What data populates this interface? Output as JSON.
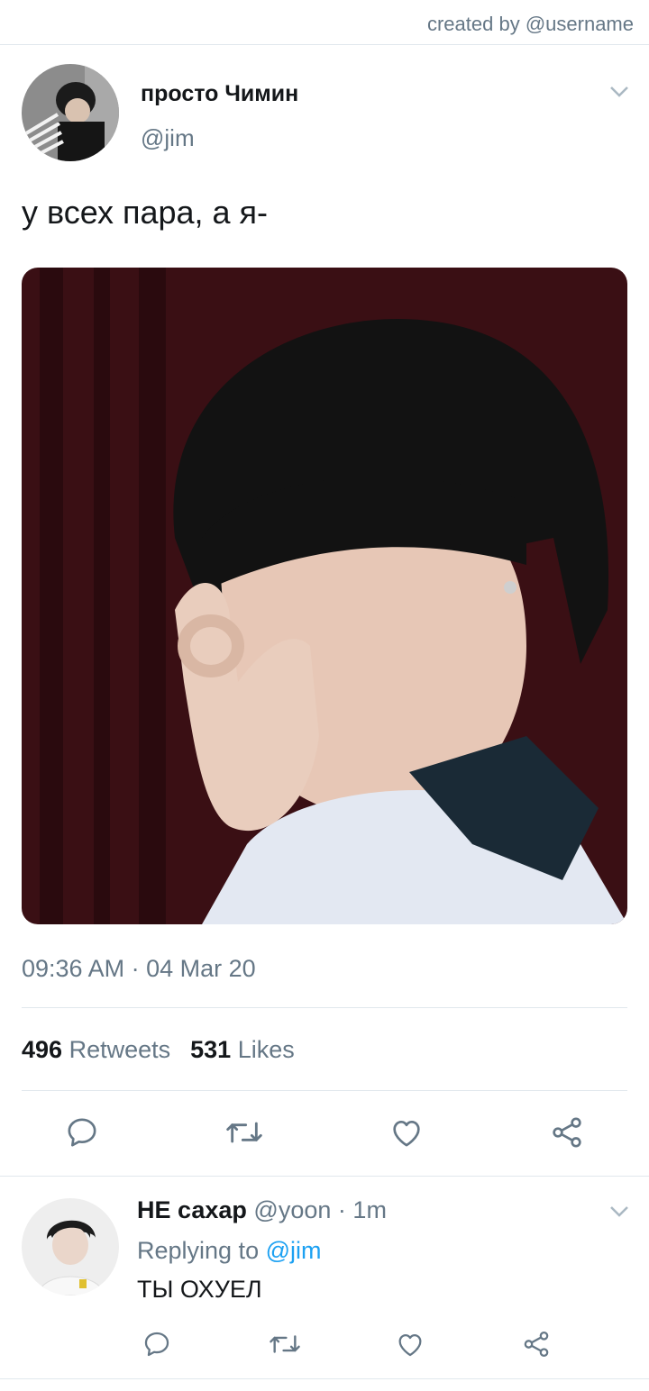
{
  "header": {
    "created_by": "created by @username"
  },
  "tweet": {
    "display_name": "просто Чимин",
    "handle": "@jim",
    "text": "у всех пара, а я-",
    "time": "09:36 AM",
    "separator": "·",
    "date": "04 Mar 20",
    "retweets_count": "496",
    "retweets_label": "Retweets",
    "likes_count": "531",
    "likes_label": "Likes"
  },
  "reply": {
    "display_name": "НЕ сахар",
    "handle": "@yoon",
    "separator": "·",
    "time_ago": "1m",
    "replying_prefix": "Replying to",
    "replying_to": "@jim",
    "text": "ТЫ ОХУЕЛ"
  },
  "icons": {
    "more": "chevron-down-icon",
    "reply": "speech-bubble-icon",
    "retweet": "retweet-icon",
    "like": "heart-icon",
    "share": "share-nodes-icon"
  },
  "colors": {
    "text": "#14171a",
    "muted": "#657786",
    "link": "#1da1f2",
    "divider": "#e1e8ed"
  }
}
